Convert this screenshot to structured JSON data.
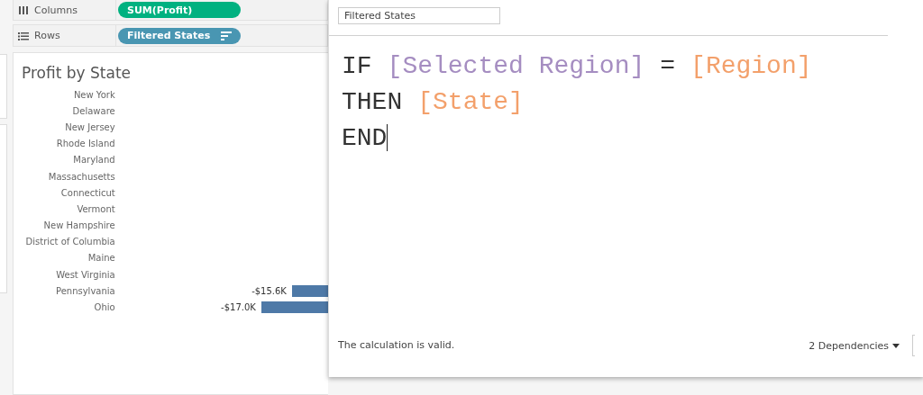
{
  "shelves": [
    {
      "kind": "columns",
      "label": "Columns",
      "pill": {
        "text": "SUM(Profit)",
        "kind": "measure",
        "sorted": false
      }
    },
    {
      "kind": "rows",
      "label": "Rows",
      "pill": {
        "text": "Filtered States",
        "kind": "dimension",
        "sorted": true
      }
    }
  ],
  "chart": {
    "title": "Profit by State",
    "rows": [
      {
        "state": "New York"
      },
      {
        "state": "Delaware"
      },
      {
        "state": "New Jersey"
      },
      {
        "state": "Rhode Island"
      },
      {
        "state": "Maryland"
      },
      {
        "state": "Massachusetts"
      },
      {
        "state": "Connecticut"
      },
      {
        "state": "Vermont"
      },
      {
        "state": "New Hampshire"
      },
      {
        "state": "District of Columbia"
      },
      {
        "state": "Maine"
      },
      {
        "state": "West Virginia"
      },
      {
        "state": "Pennsylvania",
        "value": "-$15.6K"
      },
      {
        "state": "Ohio",
        "value": "-$17.0K"
      }
    ]
  },
  "calc_dialog": {
    "name": "Filtered States",
    "formula": [
      [
        {
          "kind": "keyword",
          "text": "IF"
        },
        {
          "kind": "parameter",
          "text": "[Selected Region]"
        },
        {
          "kind": "keyword",
          "text": "="
        },
        {
          "kind": "field",
          "text": "[Region]"
        }
      ],
      [
        {
          "kind": "keyword",
          "text": "THEN"
        },
        {
          "kind": "field",
          "text": "[State]"
        }
      ],
      [
        {
          "kind": "keyword",
          "text": "END"
        }
      ]
    ],
    "status": "The calculation is valid.",
    "dependencies": "2 Dependencies"
  }
}
